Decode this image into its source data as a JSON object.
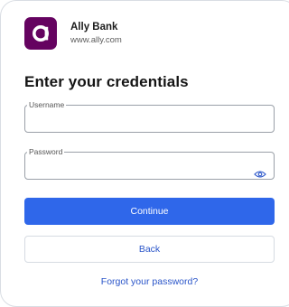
{
  "app": {
    "name": "Ally Bank",
    "url": "www.ally.com",
    "brand_color": "#650360",
    "logo_icon": "ally-logo-icon"
  },
  "form": {
    "title": "Enter your credentials",
    "username_label": "Username",
    "username_value": "",
    "password_label": "Password",
    "password_value": "",
    "password_toggle_icon": "eye-icon"
  },
  "actions": {
    "continue_label": "Continue",
    "back_label": "Back",
    "forgot_label": "Forgot your password?",
    "primary_color": "#2f67ea",
    "link_color": "#2a55c9"
  }
}
